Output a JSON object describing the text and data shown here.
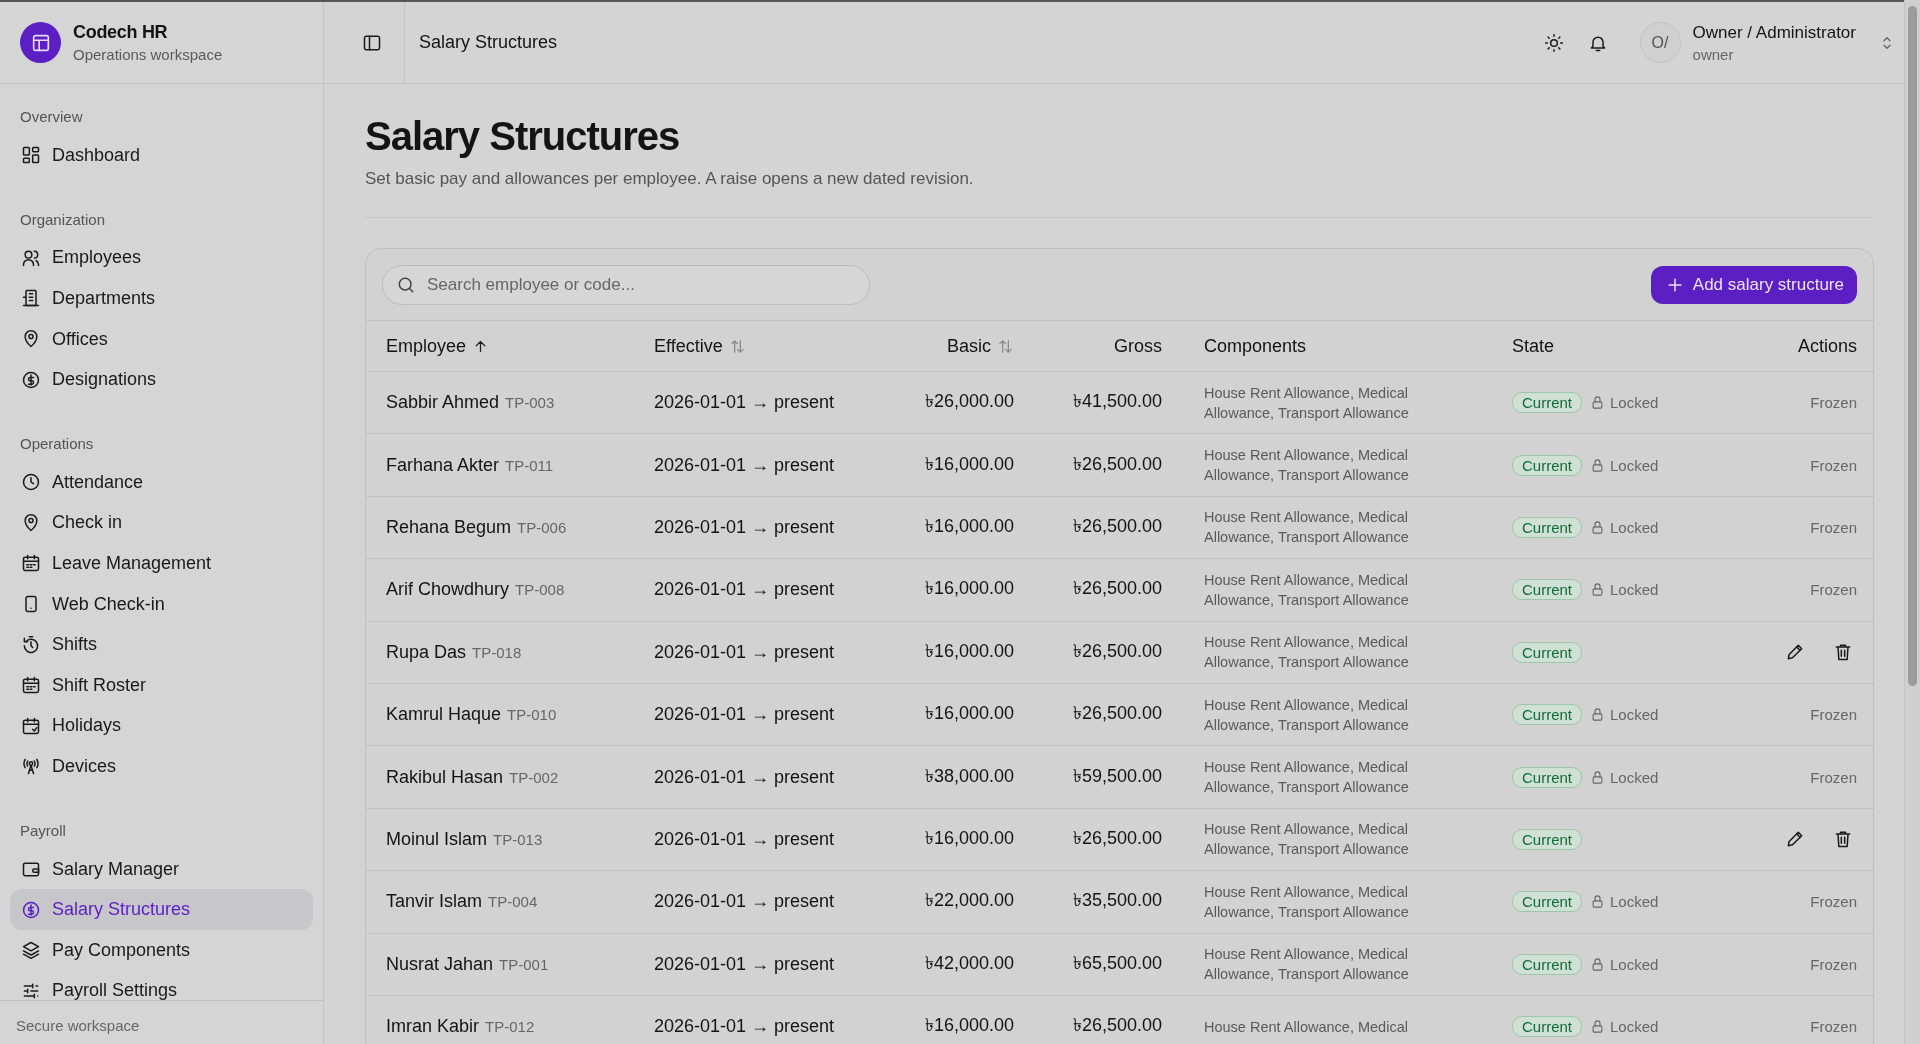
{
  "brand": {
    "name": "Codech HR",
    "subtitle": "Operations workspace"
  },
  "sidebar": {
    "sections": [
      {
        "title": "Overview",
        "items": [
          {
            "label": "Dashboard",
            "selected": false
          }
        ]
      },
      {
        "title": "Organization",
        "items": [
          {
            "label": "Employees",
            "selected": false
          },
          {
            "label": "Departments",
            "selected": false
          },
          {
            "label": "Offices",
            "selected": false
          },
          {
            "label": "Designations",
            "selected": false
          }
        ]
      },
      {
        "title": "Operations",
        "items": [
          {
            "label": "Attendance",
            "selected": false
          },
          {
            "label": "Check in",
            "selected": false
          },
          {
            "label": "Leave Management",
            "selected": false
          },
          {
            "label": "Web Check-in",
            "selected": false
          },
          {
            "label": "Shifts",
            "selected": false
          },
          {
            "label": "Shift Roster",
            "selected": false
          },
          {
            "label": "Holidays",
            "selected": false
          },
          {
            "label": "Devices",
            "selected": false
          }
        ]
      },
      {
        "title": "Payroll",
        "items": [
          {
            "label": "Salary Manager",
            "selected": false
          },
          {
            "label": "Salary Structures",
            "selected": true
          },
          {
            "label": "Pay Components",
            "selected": false
          },
          {
            "label": "Payroll Settings",
            "selected": false
          }
        ]
      }
    ],
    "footer": "Secure workspace"
  },
  "topbar": {
    "title": "Salary Structures",
    "user": {
      "initials": "O/",
      "name": "Owner / Administrator",
      "role": "owner"
    }
  },
  "page": {
    "title": "Salary Structures",
    "subtitle": "Set basic pay and allowances per employee. A raise opens a new dated revision."
  },
  "search": {
    "placeholder": "Search employee or code..."
  },
  "add_button": "Add salary structure",
  "table": {
    "columns": [
      {
        "label": "Employee",
        "sortable": true,
        "sorted": true
      },
      {
        "label": "Effective",
        "sortable": true,
        "sorted": false
      },
      {
        "label": "Basic",
        "sortable": true,
        "sorted": false
      },
      {
        "label": "Gross",
        "sortable": false,
        "sorted": false
      },
      {
        "label": "Components",
        "sortable": false,
        "sorted": false
      },
      {
        "label": "State",
        "sortable": false,
        "sorted": false
      },
      {
        "label": "Actions",
        "sortable": false,
        "sorted": false
      }
    ],
    "rows": [
      {
        "name": "Sabbir Ahmed",
        "code": "TP-003",
        "effective": "2026-01-01 → present",
        "basic": "৳26,000.00",
        "gross": "৳41,500.00",
        "components": "House Rent Allowance, Medical Allowance, Transport Allowance",
        "state": "Current",
        "locked": true,
        "lock_label": "Locked",
        "actions": "Frozen"
      },
      {
        "name": "Farhana Akter",
        "code": "TP-011",
        "effective": "2026-01-01 → present",
        "basic": "৳16,000.00",
        "gross": "৳26,500.00",
        "components": "House Rent Allowance, Medical Allowance, Transport Allowance",
        "state": "Current",
        "locked": true,
        "lock_label": "Locked",
        "actions": "Frozen"
      },
      {
        "name": "Rehana Begum",
        "code": "TP-006",
        "effective": "2026-01-01 → present",
        "basic": "৳16,000.00",
        "gross": "৳26,500.00",
        "components": "House Rent Allowance, Medical Allowance, Transport Allowance",
        "state": "Current",
        "locked": true,
        "lock_label": "Locked",
        "actions": "Frozen"
      },
      {
        "name": "Arif Chowdhury",
        "code": "TP-008",
        "effective": "2026-01-01 → present",
        "basic": "৳16,000.00",
        "gross": "৳26,500.00",
        "components": "House Rent Allowance, Medical Allowance, Transport Allowance",
        "state": "Current",
        "locked": true,
        "lock_label": "Locked",
        "actions": "Frozen"
      },
      {
        "name": "Rupa Das",
        "code": "TP-018",
        "effective": "2026-01-01 → present",
        "basic": "৳16,000.00",
        "gross": "৳26,500.00",
        "components": "House Rent Allowance, Medical Allowance, Transport Allowance",
        "state": "Current",
        "locked": false
      },
      {
        "name": "Kamrul Haque",
        "code": "TP-010",
        "effective": "2026-01-01 → present",
        "basic": "৳16,000.00",
        "gross": "৳26,500.00",
        "components": "House Rent Allowance, Medical Allowance, Transport Allowance",
        "state": "Current",
        "locked": true,
        "lock_label": "Locked",
        "actions": "Frozen"
      },
      {
        "name": "Rakibul Hasan",
        "code": "TP-002",
        "effective": "2026-01-01 → present",
        "basic": "৳38,000.00",
        "gross": "৳59,500.00",
        "components": "House Rent Allowance, Medical Allowance, Transport Allowance",
        "state": "Current",
        "locked": true,
        "lock_label": "Locked",
        "actions": "Frozen"
      },
      {
        "name": "Moinul Islam",
        "code": "TP-013",
        "effective": "2026-01-01 → present",
        "basic": "৳16,000.00",
        "gross": "৳26,500.00",
        "components": "House Rent Allowance, Medical Allowance, Transport Allowance",
        "state": "Current",
        "locked": false
      },
      {
        "name": "Tanvir Islam",
        "code": "TP-004",
        "effective": "2026-01-01 → present",
        "basic": "৳22,000.00",
        "gross": "৳35,500.00",
        "components": "House Rent Allowance, Medical Allowance, Transport Allowance",
        "state": "Current",
        "locked": true,
        "lock_label": "Locked",
        "actions": "Frozen"
      },
      {
        "name": "Nusrat Jahan",
        "code": "TP-001",
        "effective": "2026-01-01 → present",
        "basic": "৳42,000.00",
        "gross": "৳65,500.00",
        "components": "House Rent Allowance, Medical Allowance, Transport Allowance",
        "state": "Current",
        "locked": true,
        "lock_label": "Locked",
        "actions": "Frozen"
      },
      {
        "name": "Imran Kabir",
        "code": "TP-012",
        "effective": "2026-01-01 → present",
        "basic": "৳16,000.00",
        "gross": "৳26,500.00",
        "components": "House Rent Allowance, Medical",
        "state": "Current",
        "locked": true,
        "lock_label": "Locked",
        "actions": "Frozen"
      }
    ]
  }
}
